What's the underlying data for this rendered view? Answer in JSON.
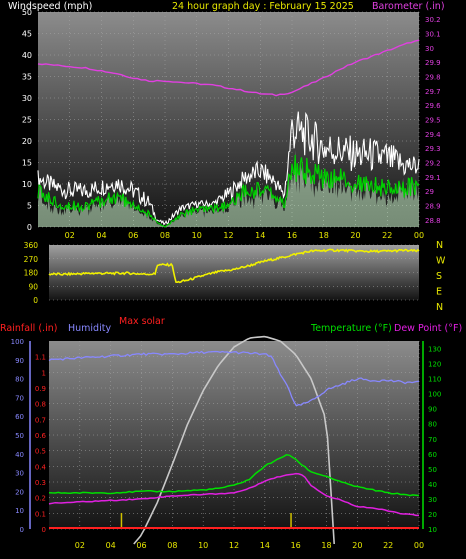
{
  "page": {
    "windspeed_label": "Windspeed (mph)",
    "title": "24 hour graph day : February 15 2025",
    "barometer_label": "Barometer (.in)",
    "max_solar_label": "Max solar",
    "rainfall_label": "Rainfall (.in)",
    "humidity_label": "Humidity",
    "temperature_label": "Temperature (°F)",
    "dewpoint_label": "Dew Point (°F)"
  },
  "colors": {
    "background": "#000000",
    "plot_top": "#8a8a8a",
    "plot_bottom": "#151515",
    "gridline": "#a8a8a8",
    "windspeed": "#ffffff",
    "wind_avg": "#00d000",
    "wind_fill": "#c8f0c8",
    "barometer": "#e040e0",
    "wind_direction": "#f0f000",
    "rainfall": "#ff2020",
    "humidity": "#8888ff",
    "temperature": "#00e000",
    "dewpoint": "#e020e0",
    "solar": "#c8c8c8",
    "title": "#e8e800",
    "axis_text": "#e8e800"
  },
  "chart_data": [
    {
      "type": "line",
      "title": "24 hour graph day : February 15 2025",
      "x_ticks": [
        "02",
        "04",
        "06",
        "08",
        "10",
        "12",
        "14",
        "16",
        "18",
        "20",
        "22",
        "00"
      ],
      "left_axis": {
        "label": "Windspeed (mph)",
        "ticks": [
          0,
          5,
          10,
          15,
          20,
          25,
          30,
          35,
          40,
          45,
          50
        ],
        "ylim": [
          0,
          50
        ]
      },
      "right_axis": {
        "label": "Barometer (.in)",
        "ticks": [
          "28.8",
          "28.9",
          "29",
          "29.1",
          "29.2",
          "29.3",
          "29.4",
          "29.5",
          "29.6",
          "29.7",
          "29.8",
          "29.9",
          "30",
          "30.1",
          "30.2"
        ],
        "ylim": [
          28.75,
          30.25
        ]
      },
      "series": [
        {
          "name": "Windspeed (mph)",
          "x": [
            0,
            1,
            2,
            3,
            4,
            5,
            6,
            7,
            7.5,
            8,
            9,
            10,
            11,
            12,
            13,
            14,
            15,
            15.5,
            16,
            17,
            18,
            19,
            20,
            21,
            22,
            23,
            24
          ],
          "values": [
            13,
            11,
            10,
            10,
            11,
            12,
            10,
            7,
            2,
            1,
            5,
            6,
            6,
            9,
            13,
            15,
            12,
            8,
            27,
            25,
            22,
            21,
            20,
            20,
            19,
            17,
            16
          ]
        },
        {
          "name": "Wind average",
          "x": [
            0,
            1,
            2,
            3,
            4,
            5,
            6,
            7,
            7.5,
            8,
            9,
            10,
            11,
            12,
            13,
            14,
            15,
            15.5,
            16,
            17,
            18,
            19,
            20,
            21,
            22,
            23,
            24
          ],
          "values": [
            8,
            6,
            5,
            5,
            6,
            7,
            5,
            3,
            1,
            0,
            3,
            4,
            4,
            5,
            8,
            9,
            7,
            5,
            14,
            13,
            11,
            11,
            10,
            10,
            9,
            9,
            10
          ]
        },
        {
          "name": "Barometer (.in)",
          "x": [
            0,
            1,
            2,
            3,
            4,
            5,
            6,
            7,
            8,
            9,
            10,
            11,
            12,
            13,
            14,
            15,
            16,
            17,
            18,
            19,
            20,
            21,
            22,
            23,
            23.5,
            24
          ],
          "values": [
            29.89,
            29.88,
            29.87,
            29.86,
            29.84,
            29.82,
            29.79,
            29.77,
            29.77,
            29.76,
            29.75,
            29.74,
            29.72,
            29.7,
            29.68,
            29.67,
            29.69,
            29.74,
            29.79,
            29.85,
            29.9,
            29.94,
            29.98,
            30.02,
            30.04,
            30.05
          ]
        }
      ]
    },
    {
      "type": "line",
      "y_ticks": [
        0,
        90,
        180,
        270,
        360
      ],
      "ylim": [
        0,
        360
      ],
      "direction_labels": [
        "N",
        "W",
        "S",
        "E",
        "N"
      ],
      "series": [
        {
          "name": "Wind direction",
          "x": [
            0,
            1,
            2,
            3,
            4,
            5,
            6,
            6.9,
            7,
            8,
            8.2,
            8.3,
            9,
            10,
            11,
            12,
            13,
            14,
            15,
            16,
            17,
            18,
            19,
            20,
            21,
            22,
            23,
            24
          ],
          "values": [
            170,
            168,
            172,
            175,
            174,
            176,
            170,
            170,
            230,
            230,
            120,
            115,
            130,
            160,
            185,
            200,
            225,
            255,
            275,
            300,
            320,
            325,
            325,
            320,
            318,
            320,
            325,
            320
          ]
        }
      ]
    },
    {
      "type": "line",
      "x_ticks": [
        "02",
        "04",
        "06",
        "08",
        "10",
        "12",
        "14",
        "16",
        "18",
        "20",
        "22",
        "00"
      ],
      "humidity_axis": {
        "label": "Humidity",
        "ticks": [
          0,
          10,
          20,
          30,
          40,
          50,
          60,
          70,
          80,
          90,
          100
        ],
        "ylim": [
          0,
          100
        ]
      },
      "rain_axis": {
        "label": "Rainfall (.in)",
        "ticks": [
          "0",
          "0.1",
          "0.2",
          "0.3",
          "0.4",
          "0.5",
          "0.6",
          "0.7",
          "0.8",
          "0.9",
          "1",
          "1.1"
        ],
        "ylim": [
          0,
          1.2
        ]
      },
      "temp_axis": {
        "label": "Temperature (°F)",
        "ticks": [
          10,
          20,
          30,
          40,
          50,
          60,
          70,
          80,
          90,
          100,
          110,
          120,
          130
        ],
        "ylim": [
          10,
          135
        ]
      },
      "series": [
        {
          "name": "Humidity",
          "x": [
            0,
            2,
            4,
            6,
            8,
            10,
            12,
            14,
            14.5,
            15,
            15.5,
            16,
            17,
            18,
            19,
            20,
            21,
            22,
            23,
            24
          ],
          "values": [
            90,
            91,
            92,
            93,
            93,
            94,
            94,
            93,
            91,
            82,
            76,
            65,
            68,
            74,
            77,
            80,
            79,
            79,
            78,
            78
          ]
        },
        {
          "name": "Temperature (°F)",
          "x": [
            0,
            2,
            4,
            6,
            8,
            10,
            11,
            12,
            13,
            14,
            15,
            15.5,
            16,
            17,
            18,
            19,
            20,
            21,
            22,
            23,
            24
          ],
          "values": [
            34,
            34,
            34,
            35,
            35,
            36,
            37,
            39,
            43,
            52,
            57,
            60,
            56,
            48,
            45,
            41,
            38,
            36,
            34,
            33,
            32
          ]
        },
        {
          "name": "Dew Point (°F)",
          "x": [
            0,
            2,
            4,
            6,
            8,
            10,
            12,
            13,
            14,
            15,
            16,
            16.5,
            17,
            18,
            19,
            20,
            21,
            22,
            23,
            24
          ],
          "values": [
            27,
            28,
            29,
            30,
            32,
            33,
            34,
            37,
            42,
            45,
            47,
            46,
            39,
            32,
            29,
            25,
            24,
            22,
            20,
            19
          ]
        },
        {
          "name": "Max solar",
          "x": [
            5.5,
            6,
            7,
            8,
            9,
            10,
            11,
            12,
            13,
            14,
            15,
            16,
            17,
            18,
            18.5
          ],
          "values": [
            0,
            6,
            27,
            53,
            80,
            102,
            119,
            131,
            137,
            138,
            135,
            126,
            110,
            82,
            0
          ]
        },
        {
          "name": "Rainfall (.in)",
          "x": [
            0,
            24
          ],
          "values": [
            0,
            0
          ]
        }
      ],
      "solar_markers": [
        4.7,
        15.7
      ]
    }
  ]
}
